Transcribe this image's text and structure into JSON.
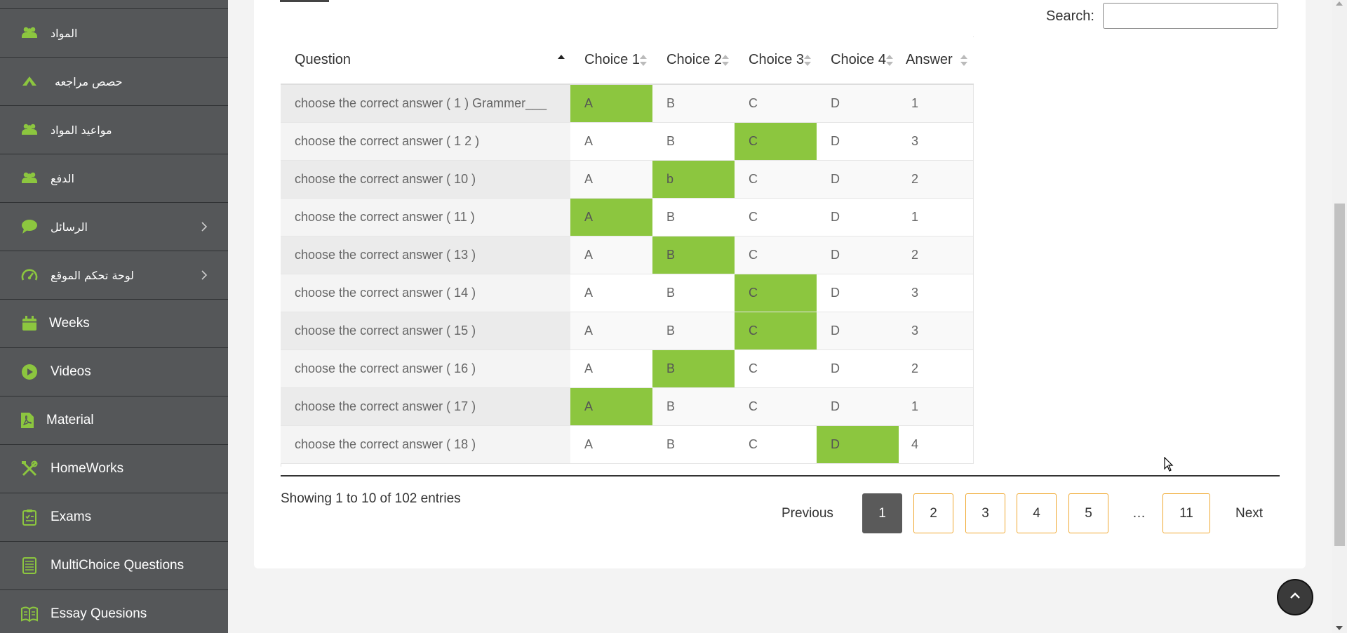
{
  "sidebar": {
    "items": [
      {
        "label": "المواد",
        "icon": "users-icon"
      },
      {
        "label": "حصص مراجعه",
        "icon": "leaf-icon"
      },
      {
        "label": "مواعيد المواد",
        "icon": "users-icon"
      },
      {
        "label": "الدفع",
        "icon": "users-icon"
      },
      {
        "label": "الرسائل",
        "icon": "chat-icon"
      },
      {
        "label": "لوحة تحكم الموقع",
        "icon": "dashboard-icon"
      },
      {
        "label": "Weeks",
        "icon": "calendar-icon"
      },
      {
        "label": "Videos",
        "icon": "play-icon"
      },
      {
        "label": "Material",
        "icon": "pdf-icon"
      },
      {
        "label": "HomeWorks",
        "icon": "tools-icon"
      },
      {
        "label": "Exams",
        "icon": "clipboard-icon"
      },
      {
        "label": "MultiChoice Questions",
        "icon": "list-icon"
      },
      {
        "label": "Essay Quesions",
        "icon": "book-icon"
      }
    ],
    "accent": "#8cc63f"
  },
  "search": {
    "label": "Search:",
    "value": ""
  },
  "table": {
    "headers": [
      "Question",
      "Choice 1",
      "Choice 2",
      "Choice 3",
      "Choice 4",
      "Answer"
    ],
    "rows": [
      {
        "question": "choose the correct answer ( 1 ) Grammer___",
        "c1": "A",
        "c2": "B",
        "c3": "C",
        "c4": "D",
        "answer": "1"
      },
      {
        "question": "choose the correct answer ( 1 2 )",
        "c1": "A",
        "c2": "B",
        "c3": "C",
        "c4": "D",
        "answer": "3"
      },
      {
        "question": "choose the correct answer ( 10 )",
        "c1": "A",
        "c2": "b",
        "c3": "C",
        "c4": "D",
        "answer": "2"
      },
      {
        "question": "choose the correct answer ( 11 )",
        "c1": "A",
        "c2": "B",
        "c3": "C",
        "c4": "D",
        "answer": "1"
      },
      {
        "question": "choose the correct answer ( 13 )",
        "c1": "A",
        "c2": "B",
        "c3": "C",
        "c4": "D",
        "answer": "2"
      },
      {
        "question": "choose the correct answer ( 14 )",
        "c1": "A",
        "c2": "B",
        "c3": "C",
        "c4": "D",
        "answer": "3"
      },
      {
        "question": "choose the correct answer ( 15 )",
        "c1": "A",
        "c2": "B",
        "c3": "C",
        "c4": "D",
        "answer": "3"
      },
      {
        "question": "choose the correct answer ( 16 )",
        "c1": "A",
        "c2": "B",
        "c3": "C",
        "c4": "D",
        "answer": "2"
      },
      {
        "question": "choose the correct answer ( 17 )",
        "c1": "A",
        "c2": "B",
        "c3": "C",
        "c4": "D",
        "answer": "1"
      },
      {
        "question": "choose the correct answer ( 18 )",
        "c1": "A",
        "c2": "B",
        "c3": "C",
        "c4": "D",
        "answer": "4"
      }
    ],
    "highlight_color": "#8cc63f"
  },
  "info": "Showing 1 to 10 of 102 entries",
  "pagination": {
    "previous": "Previous",
    "next": "Next",
    "pages": [
      "1",
      "2",
      "3",
      "4",
      "5"
    ],
    "ellipsis": "…",
    "last": "11",
    "current": "1"
  }
}
